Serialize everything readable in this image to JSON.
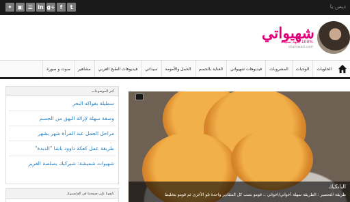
{
  "topbar": {
    "greeting": "ديس يا",
    "social_icons": [
      "rss-icon",
      "youtube-icon",
      "linkedin-icon",
      "googleplus-icon",
      "facebook-icon",
      "twitter-icon",
      "custom-icon"
    ],
    "social_glyphs": [
      "✦",
      "▣",
      "☰",
      "in",
      "g+",
      "f",
      "t"
    ]
  },
  "header": {
    "logo_text": "شهيواتي",
    "logo_tag": "100% نكهة ستيدة",
    "logo_sub": "chahiwati.com"
  },
  "nav": {
    "items": [
      "الحلويات",
      "الوجبات",
      "المشروبات",
      "فيديوهات شهيواتي",
      "العناية بالجسم",
      "الحمل والأمومة",
      "سيداتي",
      "فيديوهات الطبخ العربي",
      "مشاهير",
      "صوت و صورة"
    ]
  },
  "sidebar": {
    "recent_title": "آخر الموضوعات",
    "recent_items": [
      "سطيلة بفواكه البحر",
      "وصفة سهلة لإزالة البهق من الجسم",
      "مراحل الحمل عند المرأة شهر بشهر",
      "طريقة عمل كعكة داوود باشا \"الدبدة\"",
      "شهيوات شميشة: شيركيك بصلصة الفريز"
    ],
    "facebook_title": "تابعونا على صفحتنا في الفايسبوك"
  },
  "slider": {
    "title": "البانكيك",
    "text": "طريقة التحضير : الطريقة سهلة أخواتي/اخواتي .، قومو بصب كل المقادير واحدة تلو الأخرى ثم قومو بتخليط"
  }
}
